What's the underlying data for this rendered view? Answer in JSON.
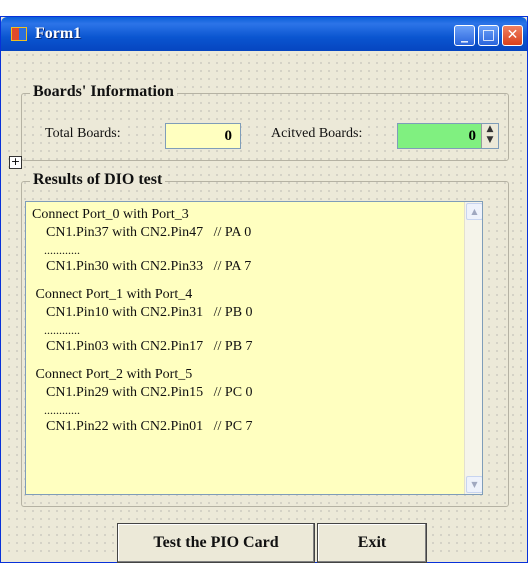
{
  "window": {
    "title": "Form1"
  },
  "titlebar_buttons": {
    "minimize": "_",
    "maximize": "□",
    "close": "✕"
  },
  "boards_group": {
    "title": "Boards' Information",
    "total_label": "Total Boards:",
    "total_value": "0",
    "active_label": "Acitved Boards:",
    "active_value": "0",
    "active_bg": "#80f080"
  },
  "results_group": {
    "title": "Results of DIO test",
    "lines": [
      "Connect Port_0 with Port_3",
      "    CN1.Pin37 with CN2.Pin47   // PA 0",
      "    ............",
      "    CN1.Pin30 with CN2.Pin33   // PA 7",
      "",
      " Connect Port_1 with Port_4",
      "    CN1.Pin10 with CN2.Pin31   // PB 0",
      "    ............",
      "    CN1.Pin03 with CN2.Pin17   // PB 7",
      "",
      " Connect Port_2 with Port_5",
      "    CN1.Pin29 with CN2.Pin15   // PC 0",
      "    ............",
      "    CN1.Pin22 with CN2.Pin01   // PC 7"
    ],
    "background": "#ffffc0"
  },
  "buttons": {
    "test_label": "Test the PIO Card",
    "exit_label": "Exit"
  }
}
